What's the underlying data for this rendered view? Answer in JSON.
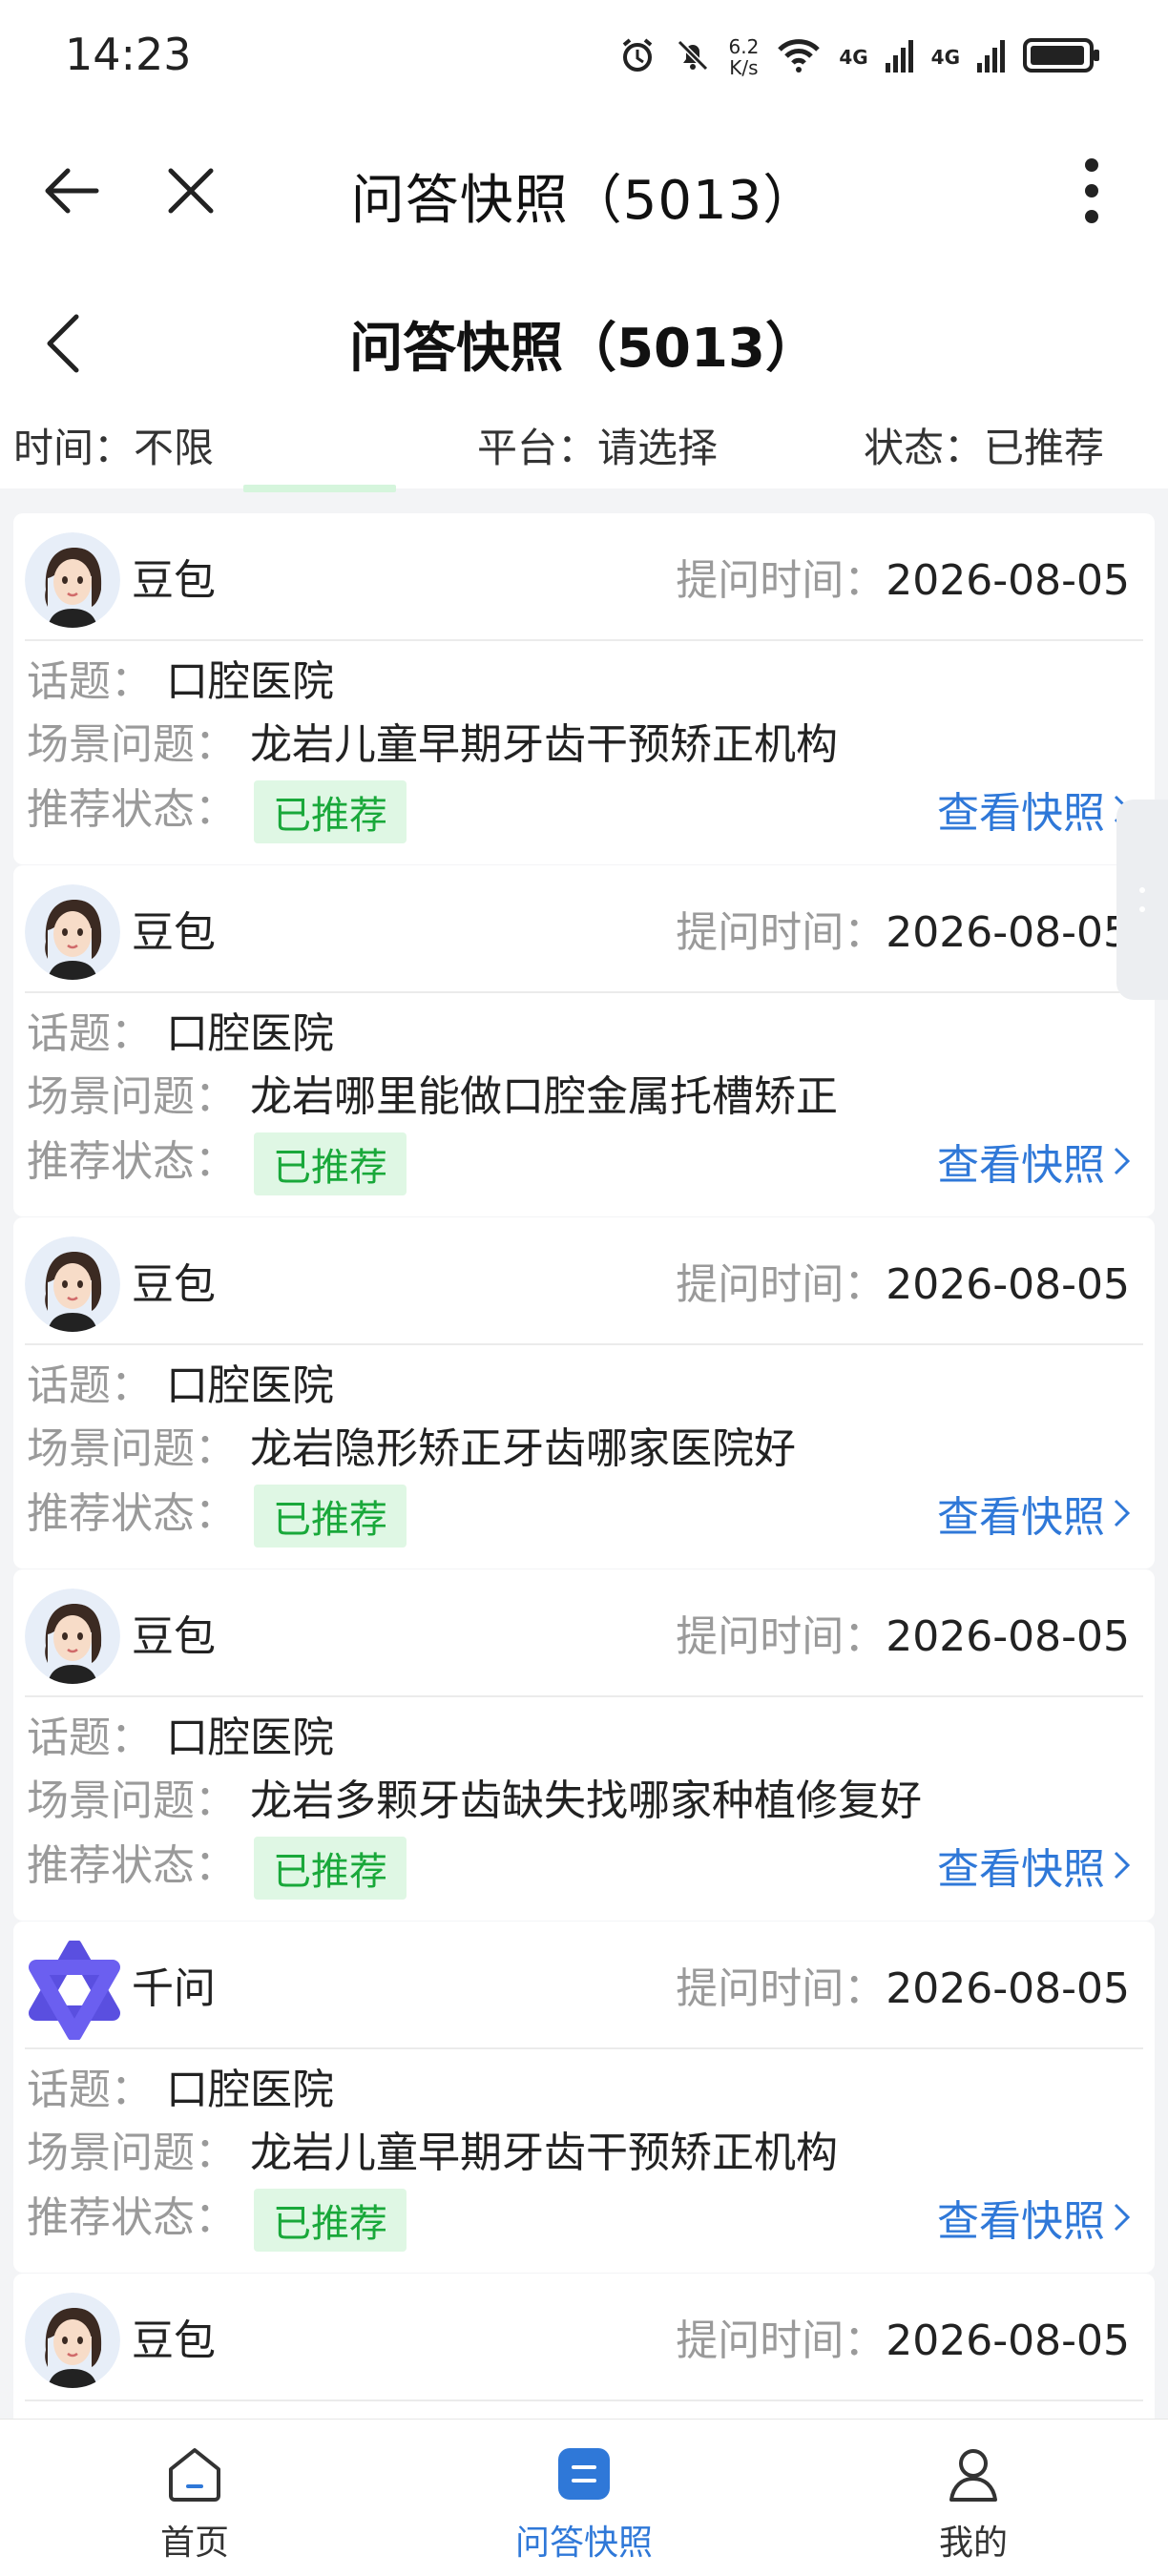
{
  "status_bar": {
    "time": "14:23",
    "speed_value": "6.2",
    "speed_unit": "K/s",
    "net_label_1": "4G",
    "net_label_2": "4G",
    "icons": [
      "alarm-icon",
      "mute-icon",
      "wifi-icon",
      "signal-icon",
      "signal-icon",
      "battery-icon"
    ]
  },
  "nav": {
    "title": "问答快照（5013）",
    "icons": [
      "back-arrow-icon",
      "close-icon",
      "more-vertical-icon"
    ]
  },
  "page": {
    "title": "问答快照（5013）"
  },
  "filters": {
    "time_label": "时间：",
    "time_value": "不限",
    "platform_label": "平台：",
    "platform_value": "请选择",
    "status_label": "状态：",
    "status_value": "已推荐"
  },
  "labels": {
    "ask_time": "提问时间：",
    "topic": "话题：",
    "question": "场景问题：",
    "status": "推荐状态：",
    "view": "查看快照"
  },
  "cards": [
    {
      "bot": "豆包",
      "avatar": "doubao-avatar",
      "time": "2026-08-05",
      "topic": "口腔医院",
      "question": "龙岩儿童早期牙齿干预矫正机构",
      "status": "已推荐"
    },
    {
      "bot": "豆包",
      "avatar": "doubao-avatar",
      "time": "2026-08-05",
      "topic": "口腔医院",
      "question": "龙岩哪里能做口腔金属托槽矫正",
      "status": "已推荐"
    },
    {
      "bot": "豆包",
      "avatar": "doubao-avatar",
      "time": "2026-08-05",
      "topic": "口腔医院",
      "question": "龙岩隐形矫正牙齿哪家医院好",
      "status": "已推荐"
    },
    {
      "bot": "豆包",
      "avatar": "doubao-avatar",
      "time": "2026-08-05",
      "topic": "口腔医院",
      "question": "龙岩多颗牙齿缺失找哪家种植修复好",
      "status": "已推荐"
    },
    {
      "bot": "千问",
      "avatar": "qianwen-logo",
      "time": "2026-08-05",
      "topic": "口腔医院",
      "question": "龙岩儿童早期牙齿干预矫正机构",
      "status": "已推荐"
    },
    {
      "bot": "豆包",
      "avatar": "doubao-avatar",
      "time": "2026-08-05"
    }
  ],
  "tabs": [
    {
      "label": "首页",
      "icon": "home-icon",
      "active": false
    },
    {
      "label": "问答快照",
      "icon": "snapshot-icon",
      "active": true
    },
    {
      "label": "我的",
      "icon": "user-icon",
      "active": false
    }
  ],
  "colors": {
    "accent": "#2f78d8",
    "badge_bg": "#dff7e4",
    "badge_text": "#19a83a",
    "qianwen": "#5a4fe0"
  }
}
